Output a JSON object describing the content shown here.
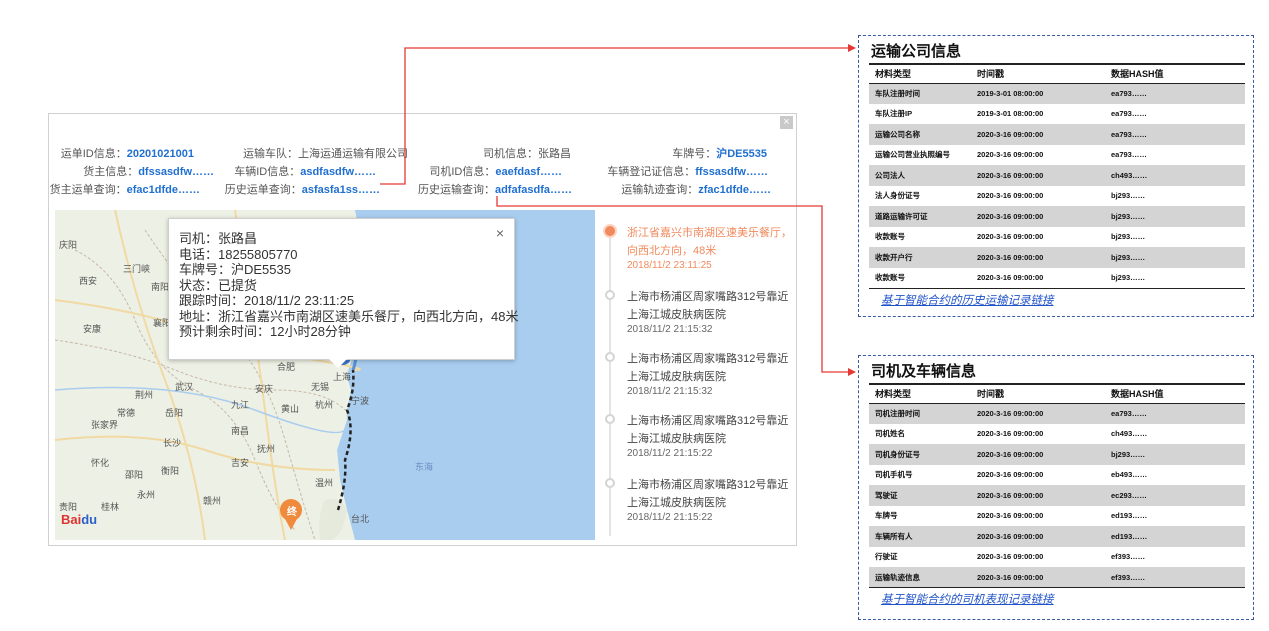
{
  "panel": {
    "close_icon": "×",
    "info": {
      "row1": [
        {
          "label": "运单ID信息：",
          "value": "20201021001"
        },
        {
          "label": "运输车队：",
          "value": "上海运通运输有限公司"
        },
        {
          "label": "司机信息：",
          "value": "张路昌"
        },
        {
          "label": "车牌号：",
          "value": "沪DE5535"
        }
      ],
      "row2": [
        {
          "label": "货主信息：",
          "value": "dfssasdfw……"
        },
        {
          "label": "车辆ID信息：",
          "value": "asdfasdfw……"
        },
        {
          "label": "司机ID信息：",
          "value": "eaefdasf……"
        },
        {
          "label": "车辆登记证信息：",
          "value": "ffssasdfw……"
        }
      ],
      "row3": [
        {
          "label": "货主运单查询：",
          "value": "efac1dfde……"
        },
        {
          "label": "历史运单查询：",
          "value": "asfasfa1ss……"
        },
        {
          "label": "历史运输查询：",
          "value": "adfafasdfa……"
        },
        {
          "label": "运输轨迹查询：",
          "value": "zfac1dfde……"
        }
      ]
    },
    "popup": {
      "close_icon": "×",
      "driver": "司机：张路昌",
      "phone": "电话：18255805770",
      "plate": "车牌号：沪DE5535",
      "status": "状态：已提货",
      "track_time": "跟踪时间：2018/11/2 23:11:25",
      "address": "地址：浙江省嘉兴市南湖区速美乐餐厅，向西北方向，48米",
      "eta": "预计剩余时间：12小时28分钟"
    },
    "map": {
      "cities": [
        "庆阳",
        "西安",
        "三门峡",
        "南阳",
        "安康",
        "襄阳",
        "武汉",
        "荆州",
        "岳阳",
        "常德",
        "张家界",
        "长沙",
        "怀化",
        "邵阳",
        "衡阳",
        "永州",
        "贵阳",
        "桂林",
        "南昌",
        "九江",
        "抚州",
        "吉安",
        "赣州",
        "安庆",
        "合肥",
        "黄山",
        "杭州",
        "宁波",
        "上海",
        "无锡",
        "温州",
        "台北",
        "阜阳",
        "三门峡",
        "巴东",
        "宜昌",
        "咸宁",
        "景德镇",
        "嘉兴",
        "苏州"
      ],
      "sea_label": "东海",
      "end_marker": "终",
      "logo_a": "Bai",
      "logo_b": "du"
    },
    "timeline": [
      {
        "address": "浙江省嘉兴市南湖区速美乐餐厅，向西北方向，48米",
        "time": "2018/11/2 23:11:25",
        "active": true
      },
      {
        "address": "上海市杨浦区周家嘴路312号靠近上海江城皮肤病医院",
        "time": "2018/11/2 21:15:32",
        "active": false
      },
      {
        "address": "上海市杨浦区周家嘴路312号靠近上海江城皮肤病医院",
        "time": "2018/11/2 21:15:32",
        "active": false
      },
      {
        "address": "上海市杨浦区周家嘴路312号靠近上海江城皮肤病医院",
        "time": "2018/11/2 21:15:22",
        "active": false
      },
      {
        "address": "上海市杨浦区周家嘴路312号靠近上海江城皮肤病医院",
        "time": "2018/11/2 21:15:22",
        "active": false
      }
    ]
  },
  "company_box": {
    "title": "运输公司信息",
    "headers": [
      "材料类型",
      "时间戳",
      "数据HASH值"
    ],
    "rows": [
      [
        "车队注册时间",
        "2019-3-01 08:00:00",
        "ea793……"
      ],
      [
        "车队注册IP",
        "2019-3-01 08:00:00",
        "ea793……"
      ],
      [
        "运输公司名称",
        "2020-3-16 09:00:00",
        "ea793……"
      ],
      [
        "运输公司营业执照编号",
        "2020-3-16 09:00:00",
        "ea793……"
      ],
      [
        "公司法人",
        "2020-3-16 09:00:00",
        "ch493……"
      ],
      [
        "法人身份证号",
        "2020-3-16 09:00:00",
        "bj293……"
      ],
      [
        "道路运输许可证",
        "2020-3-16 09:00:00",
        "bj293……"
      ],
      [
        "收款账号",
        "2020-3-16 09:00:00",
        "bj293……"
      ],
      [
        "收款开户行",
        "2020-3-16 09:00:00",
        "bj293……"
      ],
      [
        "收款账号",
        "2020-3-16 09:00:00",
        "bj293……"
      ]
    ],
    "link": "基于智能合约的历史运输记录链接"
  },
  "driver_box": {
    "title": "司机及车辆信息",
    "headers": [
      "材料类型",
      "时间戳",
      "数据HASH值"
    ],
    "rows": [
      [
        "司机注册时间",
        "2020-3-16 09:00:00",
        "ea793……"
      ],
      [
        "司机姓名",
        "2020-3-16 09:00:00",
        "ch493……"
      ],
      [
        "司机身份证号",
        "2020-3-16 09:00:00",
        "bj293……"
      ],
      [
        "司机手机号",
        "2020-3-16 09:00:00",
        "eb493……"
      ],
      [
        "驾驶证",
        "2020-3-16 09:00:00",
        "ec293……"
      ],
      [
        "车牌号",
        "2020-3-16 09:00:00",
        "ed193……"
      ],
      [
        "车辆所有人",
        "2020-3-16 09:00:00",
        "ed193……"
      ],
      [
        "行驶证",
        "2020-3-16 09:00:00",
        "ef393……"
      ],
      [
        "运输轨迹信息",
        "2020-3-16 09:00:00",
        "ef393……"
      ]
    ],
    "link": "基于智能合约的司机表现记录链接"
  },
  "colors": {
    "link_blue": "#1f6fd1",
    "connector_red": "#e53935",
    "box_border": "#3a5aa0",
    "timeline_active": "#f08a5d"
  }
}
